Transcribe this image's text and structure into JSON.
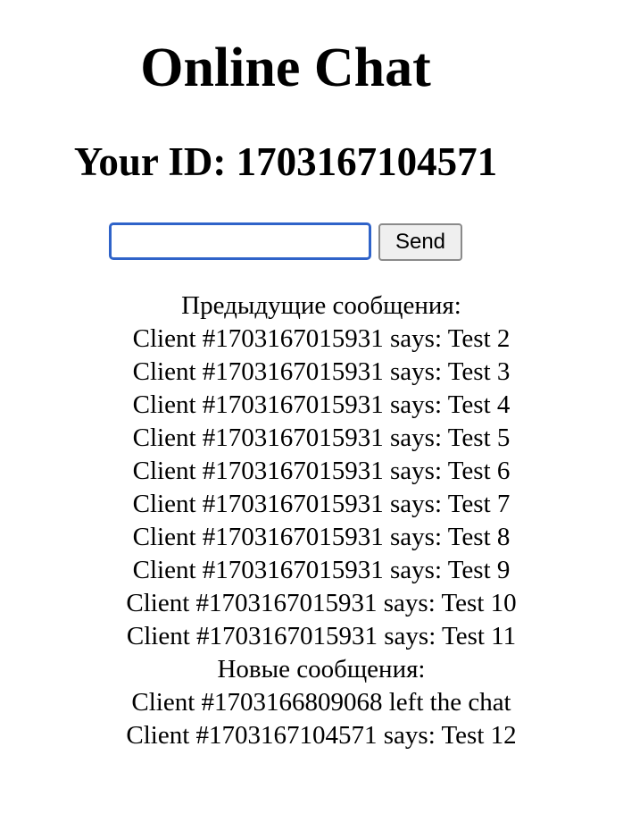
{
  "page": {
    "title": "Online Chat",
    "your_id": "Your ID: 1703167104571"
  },
  "composer": {
    "input_value": "",
    "send_label": "Send"
  },
  "messages": {
    "previous_header": "Предыдущие сообщения:",
    "previous": [
      "Client #1703167015931 says: Test 2",
      "Client #1703167015931 says: Test 3",
      "Client #1703167015931 says: Test 4",
      "Client #1703167015931 says: Test 5",
      "Client #1703167015931 says: Test 6",
      "Client #1703167015931 says: Test 7",
      "Client #1703167015931 says: Test 8",
      "Client #1703167015931 says: Test 9",
      "Client #1703167015931 says: Test 10",
      "Client #1703167015931 says: Test 11"
    ],
    "new_header": "Новые сообщения:",
    "new": [
      "Client #1703166809068 left the chat",
      "Client #1703167104571 says: Test 12"
    ]
  }
}
